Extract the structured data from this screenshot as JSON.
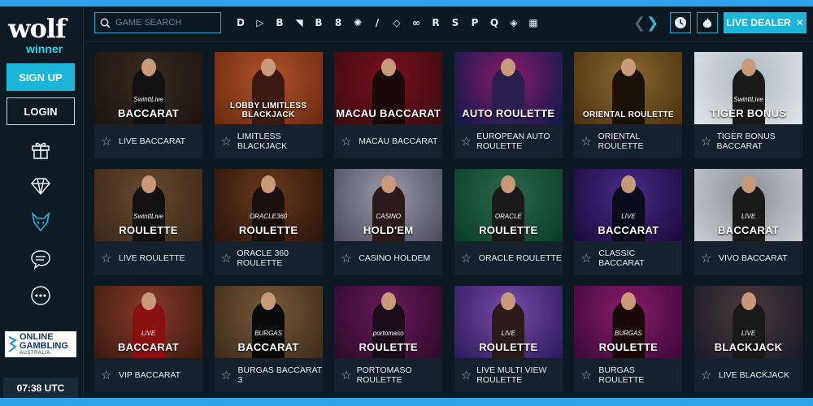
{
  "sidebar": {
    "logo_main": "wolf",
    "logo_sub": "winner",
    "signup_label": "SIGN UP",
    "login_label": "LOGIN",
    "icons": [
      "gift-icon",
      "diamond-icon",
      "wolf-icon",
      "chat-icon",
      "more-icon"
    ],
    "badge_line1": "ONLINE",
    "badge_line2": "GAMBLING",
    "badge_line3": "AUSTRALIA",
    "clock": "07:38 UTC"
  },
  "topbar": {
    "search_placeholder": "GAME SEARCH",
    "providers": [
      "D",
      "▷",
      "B",
      "◥",
      "B",
      "8",
      "✺",
      "/",
      "◇",
      "∞",
      "R",
      "S",
      "P",
      "Q",
      "◈",
      "▦"
    ],
    "live_dealer_label": "LIVE DEALER"
  },
  "colors": {
    "accent": "#1cb6d9",
    "background": "#0c1822",
    "card": "#15222d",
    "frame": "#2ba3e6"
  },
  "games": [
    {
      "title": "LIVE BACCARAT",
      "logo": "BACCARAT",
      "brand": "SwinttLive",
      "bg": [
        "#1a1410",
        "#3a2a1e"
      ],
      "fig": "#111"
    },
    {
      "title": "LIMITLESS BLACKJACK",
      "logo": "LOBBY LIMITLESS BLACKJACK",
      "brand": "",
      "bg": [
        "#6a2a10",
        "#b0522a"
      ],
      "fig": "#3a1a12"
    },
    {
      "title": "MACAU BACCARAT",
      "logo": "MACAU BACCARAT",
      "brand": "",
      "bg": [
        "#3a0a10",
        "#7a1020"
      ],
      "fig": "#1a0a0a"
    },
    {
      "title": "EUROPEAN AUTO ROULETTE",
      "logo": "AUTO ROULETTE",
      "brand": "",
      "bg": [
        "#0a1a4a",
        "#8a1a6a"
      ],
      "fig": "#2a2050"
    },
    {
      "title": "ORIENTAL ROULETTE",
      "logo": "ORIENTAL ROULETTE",
      "brand": "",
      "bg": [
        "#4a3010",
        "#8a6a30"
      ],
      "fig": "#1a1208"
    },
    {
      "title": "TIGER BONUS BACCARAT",
      "logo": "TIGER BONUS",
      "brand": "SwinttLive",
      "bg": [
        "#dfe6ea",
        "#aeb8bf"
      ],
      "fig": "#1a1a1a"
    },
    {
      "title": "LIVE ROULETTE",
      "logo": "ROULETTE",
      "brand": "SwinttLive",
      "bg": [
        "#3a2618",
        "#6a4a30"
      ],
      "fig": "#121010"
    },
    {
      "title": "ORACLE 360 ROULETTE",
      "logo": "ROULETTE",
      "brand": "ORACLE360",
      "bg": [
        "#2a140c",
        "#6a3a1a"
      ],
      "fig": "#1a0e0a"
    },
    {
      "title": "CASINO HOLDEM",
      "logo": "HOLD'EM",
      "brand": "CASINO",
      "bg": [
        "#4a4a5a",
        "#9a9aaa"
      ],
      "fig": "#2a1a1a"
    },
    {
      "title": "ORACLE ROULETTE",
      "logo": "ROULETTE",
      "brand": "ORACLE",
      "bg": [
        "#0a3a2a",
        "#2a6a4a"
      ],
      "fig": "#1a1a1a"
    },
    {
      "title": "CLASSIC BACCARAT",
      "logo": "BACCARAT",
      "brand": "LIVE",
      "bg": [
        "#1a0a3a",
        "#4a2a8a"
      ],
      "fig": "#0a0a1a"
    },
    {
      "title": "VIVO BACCARAT",
      "logo": "BACCARAT",
      "brand": "LIVE",
      "bg": [
        "#c8cdd2",
        "#8a9098"
      ],
      "fig": "#1a1a1a"
    },
    {
      "title": "VIP BACCARAT",
      "logo": "BACCARAT",
      "brand": "LIVE",
      "bg": [
        "#3a1a10",
        "#8a3a2a"
      ],
      "fig": "#8a1010"
    },
    {
      "title": "BURGAS BACCARAT 3",
      "logo": "BACCARAT",
      "brand": "BURGAS",
      "bg": [
        "#3a2a1a",
        "#7a5a3a"
      ],
      "fig": "#0a0a0a"
    },
    {
      "title": "PORTOMASO ROULETTE",
      "logo": "ROULETTE",
      "brand": "portomaso",
      "bg": [
        "#2a0a2a",
        "#6a1a5a"
      ],
      "fig": "#1a0a1a"
    },
    {
      "title": "LIVE MULTI VIEW ROULETTE",
      "logo": "ROULETTE",
      "brand": "LIVE",
      "bg": [
        "#2a1a5a",
        "#7a4aaa"
      ],
      "fig": "#2a1a1a"
    },
    {
      "title": "BURGAS ROULETTE",
      "logo": "ROULETTE",
      "brand": "BURGAS",
      "bg": [
        "#3a0a3a",
        "#8a1a6a"
      ],
      "fig": "#1a0a0a"
    },
    {
      "title": "LIVE BLACKJACK",
      "logo": "BLACKJACK",
      "brand": "LIVE",
      "bg": [
        "#1a1a2a",
        "#4a3a3a"
      ],
      "fig": "#1a1a1a"
    }
  ]
}
